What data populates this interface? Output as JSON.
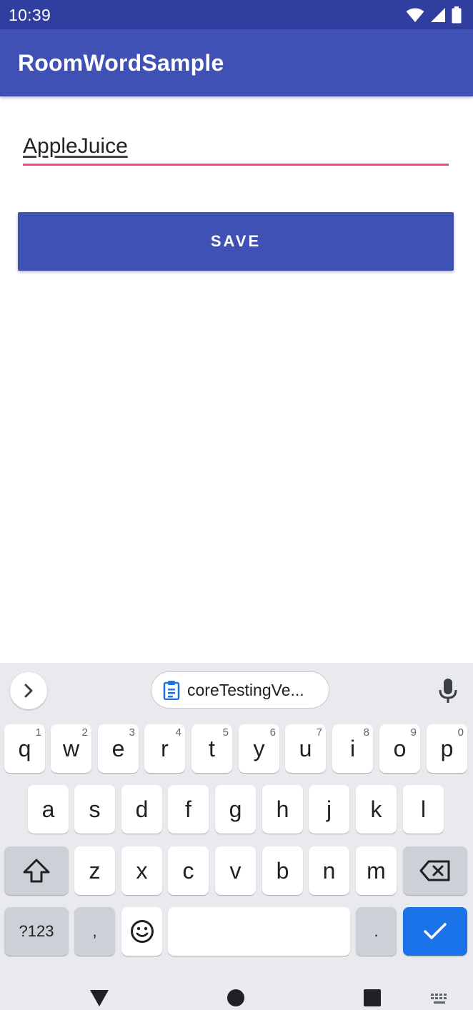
{
  "status_bar": {
    "time": "10:39",
    "icons": [
      "wifi-icon",
      "signal-icon",
      "battery-icon"
    ]
  },
  "app_bar": {
    "title": "RoomWordSample",
    "color": "#3f51b5"
  },
  "form": {
    "word_value": "AppleJuice",
    "save_label": "SAVE",
    "accent_color": "#ff4081"
  },
  "keyboard": {
    "clipboard_chip": "coreTestingVe...",
    "row1": [
      {
        "letter": "q",
        "hint": "1"
      },
      {
        "letter": "w",
        "hint": "2"
      },
      {
        "letter": "e",
        "hint": "3"
      },
      {
        "letter": "r",
        "hint": "4"
      },
      {
        "letter": "t",
        "hint": "5"
      },
      {
        "letter": "y",
        "hint": "6"
      },
      {
        "letter": "u",
        "hint": "7"
      },
      {
        "letter": "i",
        "hint": "8"
      },
      {
        "letter": "o",
        "hint": "9"
      },
      {
        "letter": "p",
        "hint": "0"
      }
    ],
    "row2": [
      "a",
      "s",
      "d",
      "f",
      "g",
      "h",
      "j",
      "k",
      "l"
    ],
    "row3": [
      "z",
      "x",
      "c",
      "v",
      "b",
      "n",
      "m"
    ],
    "symbols_label": "?123",
    "comma_label": ",",
    "period_label": ".",
    "action_color": "#1a73e8"
  },
  "nav_bar": {
    "icons": [
      "back-icon",
      "home-icon",
      "recents-icon",
      "keyboard-switch-icon"
    ]
  }
}
